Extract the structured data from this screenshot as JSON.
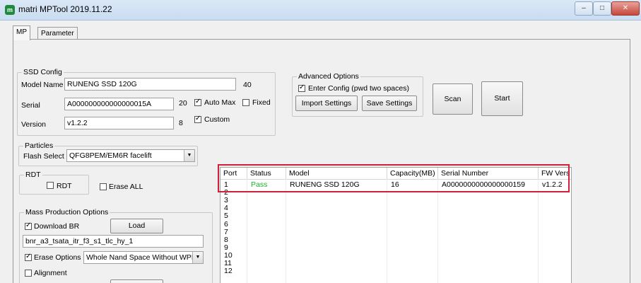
{
  "window": {
    "title": "matri MPTool 2019.11.22",
    "minimize": "–",
    "maximize": "□",
    "close": "✕"
  },
  "tabs": [
    {
      "label": "MP"
    },
    {
      "label": "Parameter"
    }
  ],
  "ssd_config": {
    "title": "SSD Config",
    "model_label": "Model Name",
    "model_value": "RUNENG SSD 120G",
    "model_len": "40",
    "serial_label": "Serial",
    "serial_value": "A000000000000000015A",
    "serial_len": "20",
    "version_label": "Version",
    "version_value": "v1.2.2",
    "version_len": "8",
    "auto_max_label": "Auto Max",
    "fixed_label": "Fixed",
    "custom_label": "Custom"
  },
  "advanced": {
    "title": "Advanced Options",
    "enter_config_label": "Enter Config (pwd two spaces)",
    "import_label": "Import Settings",
    "save_label": "Save Settings"
  },
  "actions": {
    "scan_label": "Scan",
    "start_label": "Start"
  },
  "particles": {
    "title": "Particles",
    "flash_label": "Flash Select",
    "flash_value": "QFG8PEM/EM6R facelift"
  },
  "rdt": {
    "title": "RDT",
    "rdt_label": "RDT",
    "erase_all_label": "Erase ALL"
  },
  "mass_prod": {
    "title": "Mass Production Options",
    "download_br_label": "Download BR",
    "load_label": "Load",
    "br_file": "bnr_a3_tsata_itr_f3_s1_tlc_hy_1",
    "erase_options_label": "Erase Options",
    "erase_value": "Whole Nand Space Without WPE",
    "alignment_label": "Alignment"
  },
  "port_table": {
    "columns": [
      "Port",
      "Status",
      "Model",
      "Capacity(MB)",
      "Serial Number",
      "FW Vers"
    ],
    "rows": [
      {
        "port": "1",
        "status": "Pass",
        "model": "RUNENG SSD 120G",
        "capacity": "16",
        "serial": "A0000000000000000159",
        "fw": "v1.2.2"
      },
      {
        "port": "2",
        "status": "",
        "model": "",
        "capacity": "",
        "serial": "",
        "fw": ""
      },
      {
        "port": "3",
        "status": "",
        "model": "",
        "capacity": "",
        "serial": "",
        "fw": ""
      },
      {
        "port": "4",
        "status": "",
        "model": "",
        "capacity": "",
        "serial": "",
        "fw": ""
      },
      {
        "port": "5",
        "status": "",
        "model": "",
        "capacity": "",
        "serial": "",
        "fw": ""
      },
      {
        "port": "6",
        "status": "",
        "model": "",
        "capacity": "",
        "serial": "",
        "fw": ""
      },
      {
        "port": "7",
        "status": "",
        "model": "",
        "capacity": "",
        "serial": "",
        "fw": ""
      },
      {
        "port": "8",
        "status": "",
        "model": "",
        "capacity": "",
        "serial": "",
        "fw": ""
      },
      {
        "port": "9",
        "status": "",
        "model": "",
        "capacity": "",
        "serial": "",
        "fw": ""
      },
      {
        "port": "10",
        "status": "",
        "model": "",
        "capacity": "",
        "serial": "",
        "fw": ""
      },
      {
        "port": "11",
        "status": "",
        "model": "",
        "capacity": "",
        "serial": "",
        "fw": ""
      },
      {
        "port": "12",
        "status": "",
        "model": "",
        "capacity": "",
        "serial": "",
        "fw": ""
      }
    ]
  },
  "colors": {
    "pass": "#1fb12a",
    "highlight": "#d2203b"
  }
}
